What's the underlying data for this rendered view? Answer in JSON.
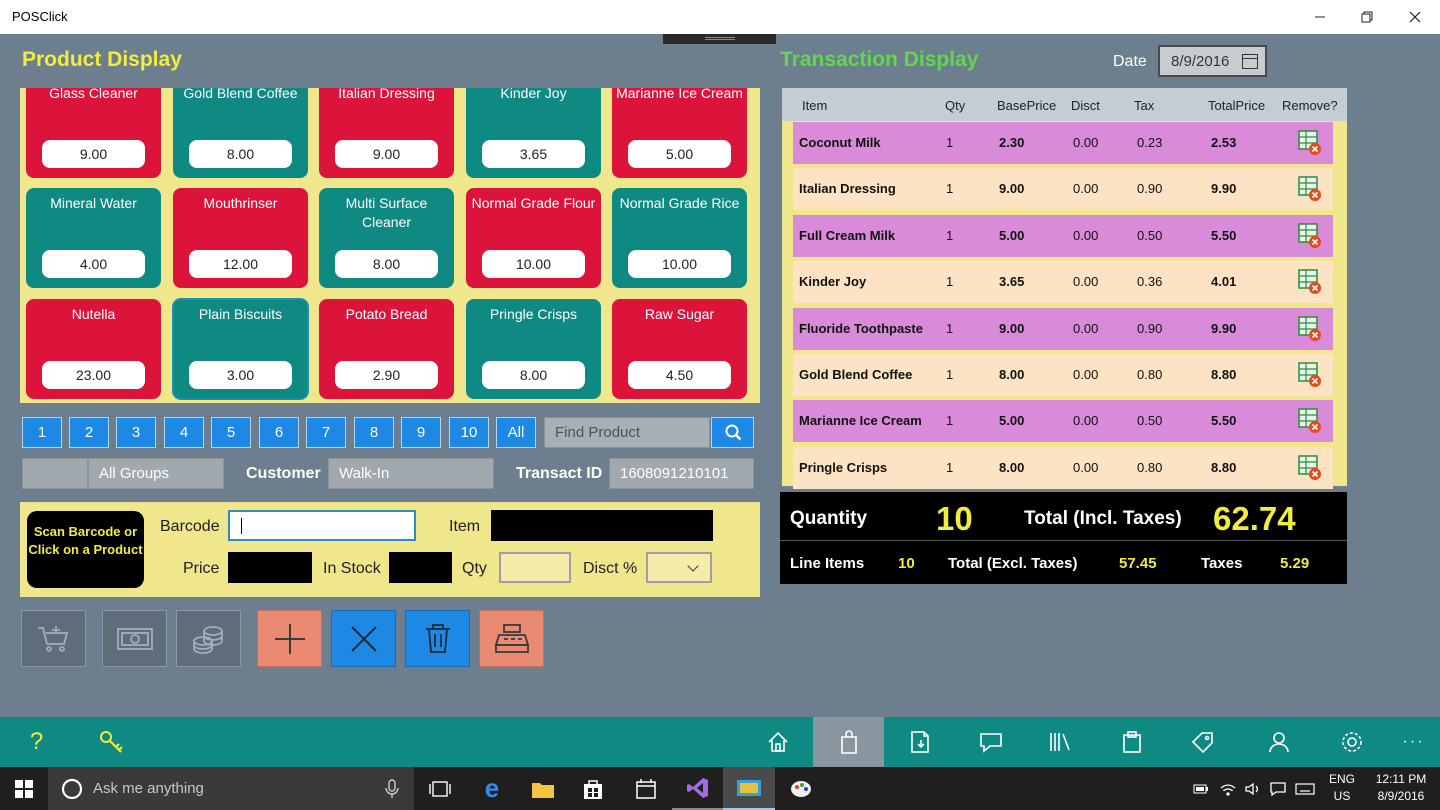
{
  "window": {
    "title": "POSClick"
  },
  "product_display": {
    "title": "Product Display",
    "tiles": [
      {
        "name": "Glass Cleaner",
        "price": "9.00",
        "color": "red"
      },
      {
        "name": "Gold Blend Coffee",
        "price": "8.00",
        "color": "teal"
      },
      {
        "name": "Italian Dressing",
        "price": "9.00",
        "color": "red"
      },
      {
        "name": "Kinder Joy",
        "price": "3.65",
        "color": "teal"
      },
      {
        "name": "Marianne Ice Cream",
        "price": "5.00",
        "color": "red"
      },
      {
        "name": "Mineral Water",
        "price": "4.00",
        "color": "teal"
      },
      {
        "name": "Mouthrinser",
        "price": "12.00",
        "color": "red"
      },
      {
        "name": "Multi Surface Cleaner",
        "price": "8.00",
        "color": "teal"
      },
      {
        "name": "Normal Grade Flour",
        "price": "10.00",
        "color": "red"
      },
      {
        "name": "Normal Grade Rice",
        "price": "10.00",
        "color": "teal"
      },
      {
        "name": "Nutella",
        "price": "23.00",
        "color": "red"
      },
      {
        "name": "Plain Biscuits",
        "price": "3.00",
        "color": "teal",
        "selected": true
      },
      {
        "name": "Potato Bread",
        "price": "2.90",
        "color": "red"
      },
      {
        "name": "Pringle Crisps",
        "price": "8.00",
        "color": "teal"
      },
      {
        "name": "Raw Sugar",
        "price": "4.50",
        "color": "red"
      }
    ],
    "pager": [
      "1",
      "2",
      "3",
      "4",
      "5",
      "6",
      "7",
      "8",
      "9",
      "10",
      "All"
    ],
    "find_placeholder": "Find Product",
    "group": "All Groups",
    "customer_label": "Customer",
    "customer_value": "Walk-In",
    "transact_label": "Transact ID",
    "transact_value": "1608091210101"
  },
  "entry": {
    "scan_text": "Scan Barcode or Click on a Product",
    "barcode_label": "Barcode",
    "item_label": "Item",
    "price_label": "Price",
    "instock_label": "In Stock",
    "qty_label": "Qty",
    "disct_label": "Disct %"
  },
  "transaction_display": {
    "title": "Transaction Display",
    "date_label": "Date",
    "date_value": "8/9/2016",
    "columns": [
      "Item",
      "Qty",
      "BasePrice",
      "Disct",
      "Tax",
      "TotalPrice",
      "Remove?"
    ],
    "rows": [
      {
        "item": "Coconut Milk",
        "qty": "1",
        "base": "2.30",
        "disct": "0.00",
        "tax": "0.23",
        "total": "2.53"
      },
      {
        "item": "Italian Dressing",
        "qty": "1",
        "base": "9.00",
        "disct": "0.00",
        "tax": "0.90",
        "total": "9.90"
      },
      {
        "item": "Full Cream Milk",
        "qty": "1",
        "base": "5.00",
        "disct": "0.00",
        "tax": "0.50",
        "total": "5.50"
      },
      {
        "item": "Kinder Joy",
        "qty": "1",
        "base": "3.65",
        "disct": "0.00",
        "tax": "0.36",
        "total": "4.01"
      },
      {
        "item": "Fluoride Toothpaste",
        "qty": "1",
        "base": "9.00",
        "disct": "0.00",
        "tax": "0.90",
        "total": "9.90"
      },
      {
        "item": "Gold Blend Coffee",
        "qty": "1",
        "base": "8.00",
        "disct": "0.00",
        "tax": "0.80",
        "total": "8.80"
      },
      {
        "item": "Marianne Ice Cream",
        "qty": "1",
        "base": "5.00",
        "disct": "0.00",
        "tax": "0.50",
        "total": "5.50"
      },
      {
        "item": "Pringle Crisps",
        "qty": "1",
        "base": "8.00",
        "disct": "0.00",
        "tax": "0.80",
        "total": "8.80"
      }
    ]
  },
  "totals": {
    "quantity_label": "Quantity",
    "quantity_value": "10",
    "total_incl_label": "Total (Incl. Taxes)",
    "total_incl_value": "62.74",
    "line_items_label": "Line Items",
    "line_items_value": "10",
    "total_excl_label": "Total (Excl. Taxes)",
    "total_excl_value": "57.45",
    "taxes_label": "Taxes",
    "taxes_value": "5.29"
  },
  "taskbar": {
    "search_placeholder": "Ask me anything",
    "lang": "ENG",
    "region": "US",
    "time": "12:11 PM",
    "date": "8/9/2016"
  },
  "colors": {
    "accent_yellow": "#f2ec3c",
    "accent_green": "#5fd84a",
    "tile_red": "#dc143c",
    "tile_teal": "#0e8a82",
    "panel_bg": "#f0e68c",
    "row_purple": "#d98bd9",
    "row_peach": "#fbe3c3"
  }
}
